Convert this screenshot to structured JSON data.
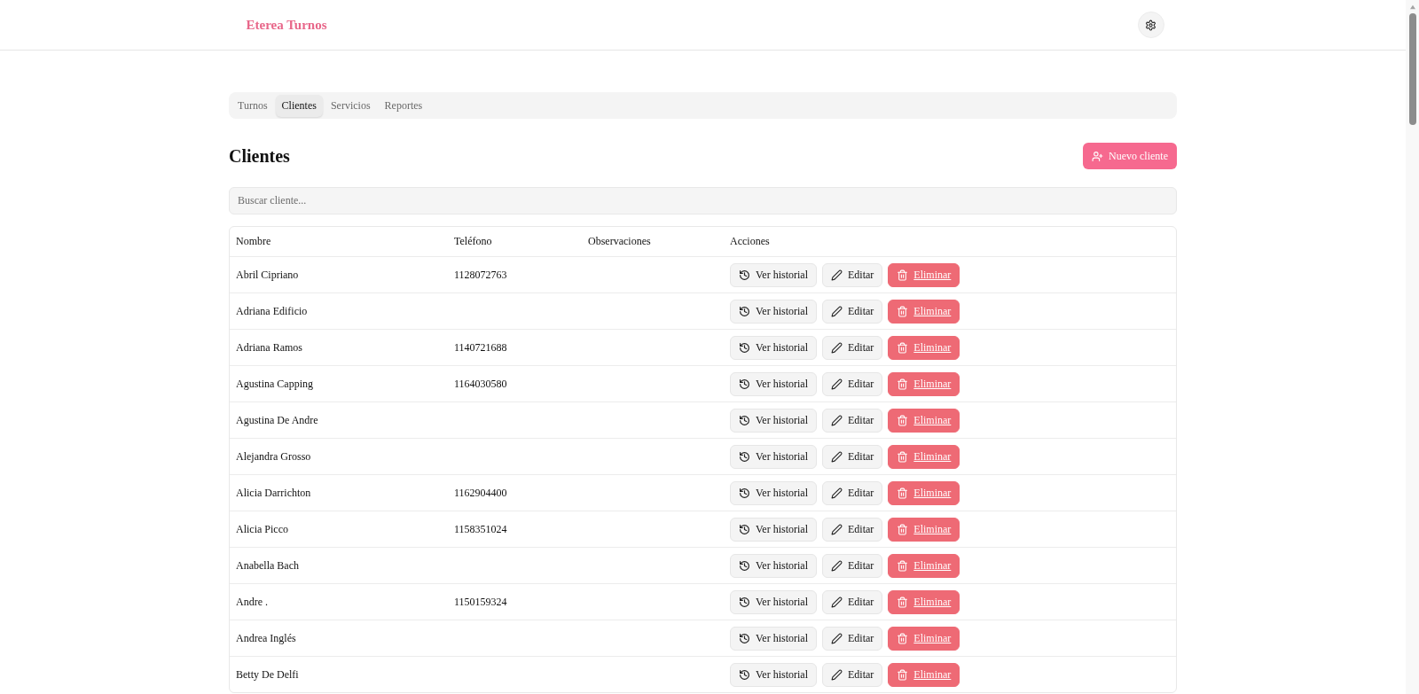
{
  "header": {
    "logo": "Eterea Turnos"
  },
  "tabs": [
    {
      "label": "Turnos",
      "selected": false
    },
    {
      "label": "Clientes",
      "selected": true
    },
    {
      "label": "Servicios",
      "selected": false
    },
    {
      "label": "Reportes",
      "selected": false
    }
  ],
  "page": {
    "title": "Clientes",
    "new_button": "Nuevo cliente"
  },
  "search": {
    "placeholder": "Buscar cliente..."
  },
  "table": {
    "columns": [
      "Nombre",
      "Teléfono",
      "Observaciones",
      "Acciones"
    ],
    "rows": [
      {
        "name": "Abril Cipriano",
        "phone": "1128072763",
        "actions": [
          {
            "kind": "history",
            "label": "Ver historial"
          },
          {
            "kind": "edit",
            "label": "Editar"
          },
          {
            "kind": "delete",
            "label": "Eliminar"
          }
        ]
      },
      {
        "name": "Adriana Edificio",
        "actions": [
          {
            "kind": "history",
            "label": "Ver historial"
          },
          {
            "kind": "edit",
            "label": "Editar"
          },
          {
            "kind": "delete",
            "label": "Eliminar"
          }
        ]
      },
      {
        "name": "Adriana Ramos",
        "phone": "1140721688",
        "actions": [
          {
            "kind": "history",
            "label": "Ver historial"
          },
          {
            "kind": "edit",
            "label": "Editar"
          },
          {
            "kind": "delete",
            "label": "Eliminar"
          }
        ]
      },
      {
        "name": "Agustina Capping",
        "phone": "1164030580",
        "actions": [
          {
            "kind": "history",
            "label": "Ver historial"
          },
          {
            "kind": "edit",
            "label": "Editar"
          },
          {
            "kind": "delete",
            "label": "Eliminar"
          }
        ]
      },
      {
        "name": "Agustina De Andre",
        "actions": [
          {
            "kind": "history",
            "label": "Ver historial"
          },
          {
            "kind": "edit",
            "label": "Editar"
          },
          {
            "kind": "delete",
            "label": "Eliminar"
          }
        ]
      },
      {
        "name": "Alejandra Grosso",
        "actions": [
          {
            "kind": "history",
            "label": "Ver historial"
          },
          {
            "kind": "edit",
            "label": "Editar"
          },
          {
            "kind": "delete",
            "label": "Eliminar"
          }
        ]
      },
      {
        "name": "Alicia Darrichton",
        "phone": "1162904400",
        "actions": [
          {
            "kind": "history",
            "label": "Ver historial"
          },
          {
            "kind": "edit",
            "label": "Editar"
          },
          {
            "kind": "delete",
            "label": "Eliminar"
          }
        ]
      },
      {
        "name": "Alicia Picco",
        "phone": "1158351024",
        "actions": [
          {
            "kind": "history",
            "label": "Ver historial"
          },
          {
            "kind": "edit",
            "label": "Editar"
          },
          {
            "kind": "delete",
            "label": "Eliminar"
          }
        ]
      },
      {
        "name": "Anabella Bach",
        "actions": [
          {
            "kind": "history",
            "label": "Ver historial"
          },
          {
            "kind": "edit",
            "label": "Editar"
          },
          {
            "kind": "delete",
            "label": "Eliminar"
          }
        ]
      },
      {
        "name": "Andre .",
        "phone": "1150159324",
        "actions": [
          {
            "kind": "history",
            "label": "Ver historial"
          },
          {
            "kind": "edit",
            "label": "Editar"
          },
          {
            "kind": "delete",
            "label": "Eliminar"
          }
        ]
      },
      {
        "name": "Andrea Inglés",
        "actions": [
          {
            "kind": "history",
            "label": "Ver historial"
          },
          {
            "kind": "edit",
            "label": "Editar"
          },
          {
            "kind": "delete",
            "label": "Eliminar"
          }
        ]
      },
      {
        "name": "Betty De Delfi",
        "actions": [
          {
            "kind": "history",
            "label": "Ver historial"
          },
          {
            "kind": "edit",
            "label": "Editar"
          },
          {
            "kind": "delete",
            "label": "Eliminar"
          }
        ]
      }
    ]
  }
}
